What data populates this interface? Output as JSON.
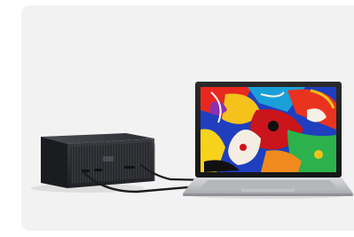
{
  "scene": {
    "background_color": "#f2f2f3",
    "device_color": "#2b2d31",
    "laptop_body_color": "#c9cacd",
    "cable_color": "#1c1c1e"
  },
  "logo_icon": "brand-logo-icon"
}
